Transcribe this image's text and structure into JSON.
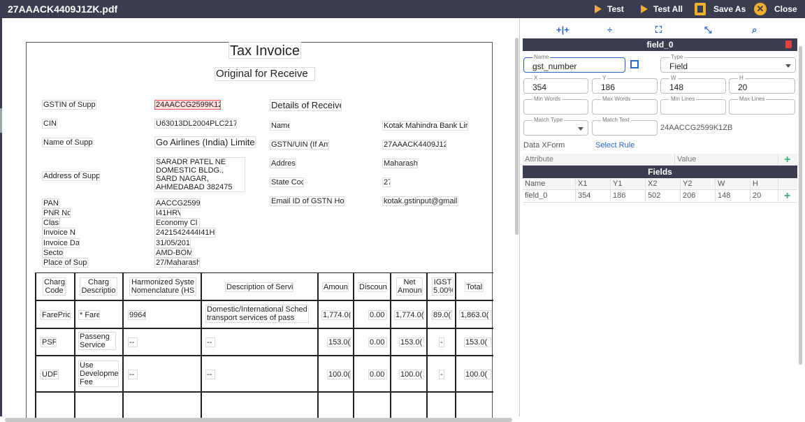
{
  "app": {
    "filename": "27AAACK4409J1ZK.pdf"
  },
  "toolbar": {
    "test_label": "Test",
    "test_all_label": "Test All",
    "save_as_label": "Save As",
    "close_label": "Close",
    "close_glyph": "✕"
  },
  "invoice": {
    "title": "Tax Invoice",
    "subtitle": "Original for Receive",
    "supplier_labels": [
      "GSTIN of Suppl",
      "CIN:",
      "Name of Supp",
      "Address of Supp",
      "PAN",
      "PNR Nc",
      "Class",
      "Invoice N",
      "Invoice Da",
      "Secto",
      "Place of Sup"
    ],
    "supplier_values": {
      "gstin": "24AACCG2599K12",
      "cin": "U63013DL2004PLC217",
      "name": "Go Airlines (India) Limite",
      "address": "SARADR PATEL NE DOMESTIC BLDG., SARD NAGAR, AHMEDABAD 382475",
      "pan": "AACCG2599",
      "pnr": "I41HRV",
      "class": "Economy Cl",
      "invoice_no": "2421542444I41H",
      "invoice_date": "31/05/201",
      "sector": "AMD-BOM",
      "place": "27/Maharash"
    },
    "receiver_heading": "Details of Receive",
    "receiver_labels": [
      "Name",
      "GSTN/UIN (If Any",
      "Addres",
      "State Coc",
      "Email ID of GSTN Ho"
    ],
    "receiver_values": [
      "Kotak Mahindra Bank Lir",
      "27AAACK4409J12",
      "Maharash",
      "27",
      "kotak.gstinput@gmail"
    ],
    "table_headers": [
      "Charg Code",
      "Charg Descriptio",
      "Harmonized Syste Nomenclature (HS",
      "Description of Servi",
      "Amoun",
      "Discoun",
      "Net Amoun",
      "IGST 5.00%",
      "Total"
    ],
    "rows": [
      [
        "FarePric",
        "* Fare",
        "9964",
        "Domestic/International Sched transport services of pass",
        "1,774.0(",
        "0.00",
        "1,774.0(",
        "89.0(",
        "1,863.0("
      ],
      [
        "PSF",
        "Passeng Service Fe",
        "--",
        "--",
        "153.0(",
        "0.00",
        "153.0(",
        "-",
        "153.0("
      ],
      [
        "UDF",
        "Use Developme Fee",
        "--",
        "--",
        "100.0(",
        "0.00",
        "100.0(",
        "-",
        "100.0("
      ]
    ]
  },
  "panel": {
    "icons": [
      "expand-horizontal-icon",
      "expand-vertical-icon",
      "fullscreen-icon",
      "collapse-icon",
      "zoom-icon"
    ],
    "field_title": "field_0",
    "name_label": "Name",
    "name_value": "gst_number",
    "type_label": "Type",
    "type_value": "Field",
    "x_label": "X",
    "x_value": "354",
    "y_label": "Y",
    "y_value": "186",
    "w_label": "W",
    "w_value": "148",
    "h_label": "H",
    "h_value": "20",
    "min_words_label": "Min Words",
    "max_words_label": "Max Words",
    "min_lines_label": "Min Lines",
    "max_lines_label": "Max Lines",
    "match_type_label": "Match Type",
    "match_text_label": "Match Text",
    "match_preview": "24AACCG2599K1ZB",
    "data_xform_label": "Data XForm",
    "select_rule_label": "Select Rule",
    "attr_header": "Attribute",
    "value_header": "Value",
    "fields_title": "Fields",
    "fields_columns": [
      "Name",
      "X1",
      "Y1",
      "X2",
      "Y2",
      "W",
      "H"
    ],
    "fields_rows": [
      [
        "field_0",
        "354",
        "186",
        "502",
        "206",
        "148",
        "20"
      ]
    ]
  },
  "colors": {
    "topbar": "#3a3d50",
    "accent": "#f0b02a",
    "link": "#2a66c8",
    "add": "#3cb371",
    "delete": "#e04040"
  }
}
